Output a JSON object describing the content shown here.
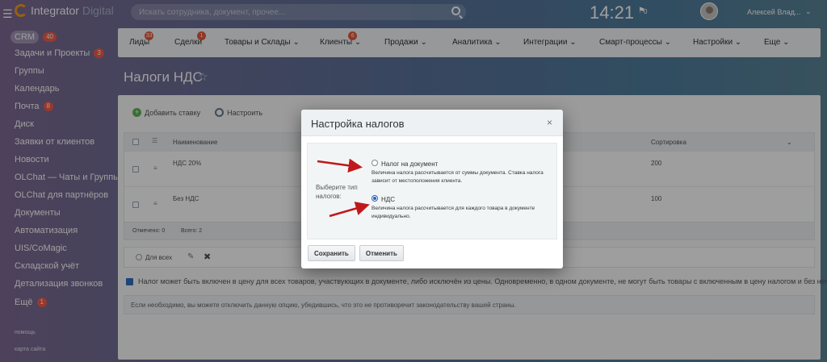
{
  "header": {
    "logo_text": "Integrator",
    "logo_sub": "Digital",
    "search_placeholder": "Искать сотрудника, документ, прочее...",
    "clock": "14:21",
    "flag_count": "0",
    "user_name": "Алексей Влад..."
  },
  "sidebar": {
    "items": [
      {
        "label": "CRM",
        "badge": "40",
        "active": true
      },
      {
        "label": "Задачи и Проекты",
        "badge": "3"
      },
      {
        "label": "Группы",
        "badge": ""
      },
      {
        "label": "Календарь",
        "badge": ""
      },
      {
        "label": "Почта",
        "badge": "8"
      },
      {
        "label": "Диск",
        "badge": ""
      },
      {
        "label": "Заявки от клиентов",
        "badge": ""
      },
      {
        "label": "Новости",
        "badge": ""
      },
      {
        "label": "OLChat — Чаты и Группы...",
        "badge": ""
      },
      {
        "label": "OLChat для партнёров",
        "badge": ""
      },
      {
        "label": "Документы",
        "badge": ""
      },
      {
        "label": "Автоматизация",
        "badge": ""
      },
      {
        "label": "UIS/CoMagic",
        "badge": ""
      },
      {
        "label": "Складской учёт",
        "badge": ""
      },
      {
        "label": "Детализация звонков",
        "badge": ""
      },
      {
        "label": "Ещё",
        "badge": "1"
      }
    ],
    "help": "помощь",
    "sitemap": "карта сайта"
  },
  "nav": {
    "items": [
      {
        "label": "Лиды",
        "badge": "33"
      },
      {
        "label": "Сделки",
        "badge": "1"
      },
      {
        "label": "Товары и Склады ⌄",
        "badge": ""
      },
      {
        "label": "Клиенты ⌄",
        "badge": "6"
      },
      {
        "label": "Продажи ⌄",
        "badge": ""
      },
      {
        "label": "Аналитика ⌄",
        "badge": ""
      },
      {
        "label": "Интеграции ⌄",
        "badge": ""
      },
      {
        "label": "Смарт-процессы ⌄",
        "badge": ""
      },
      {
        "label": "Настройки ⌄",
        "badge": ""
      },
      {
        "label": "Еще ⌄",
        "badge": ""
      }
    ]
  },
  "page": {
    "title": "Налоги НДС",
    "toolbar": {
      "add": "Добавить ставку",
      "settings": "Настроить"
    },
    "table": {
      "col_name": "Наименование",
      "col_sort": "Сортировка",
      "rows": [
        {
          "name": "НДС 20%",
          "sort": "200"
        },
        {
          "name": "Без НДС",
          "sort": "100"
        }
      ],
      "footer_selected": "Отмечено: 0",
      "footer_total": "Всего: 2"
    },
    "actions": {
      "for_all": "Для всех"
    },
    "note_checkbox": "Налог может быть включен в цену для всех товаров, участвующих в документе, либо исключён из цены. Одновременно, в одном документе, не могут быть товары с включенным в цену налогом и без него.",
    "note_text": "Если необходимо, вы можете отключить данную опцию, убедившись, что это не противоречит законодательству вашей страны."
  },
  "dialog": {
    "title": "Настройка налогов",
    "close": "×",
    "type_label": "Выберите тип налогов:",
    "option1_title": "Налог на документ",
    "option1_desc": "Величина налога рассчитывается от суммы документа. Ставка налога зависит от местоположения клиента.",
    "option2_title": "НДС",
    "option2_desc": "Величина налога рассчитывается для каждого товара в документе индивидуально.",
    "save": "Сохранить",
    "cancel": "Отменить"
  },
  "colors": {
    "arrow": "#c0191b",
    "badge": "#f25c4a",
    "radio_checked": "#2a64b5"
  }
}
